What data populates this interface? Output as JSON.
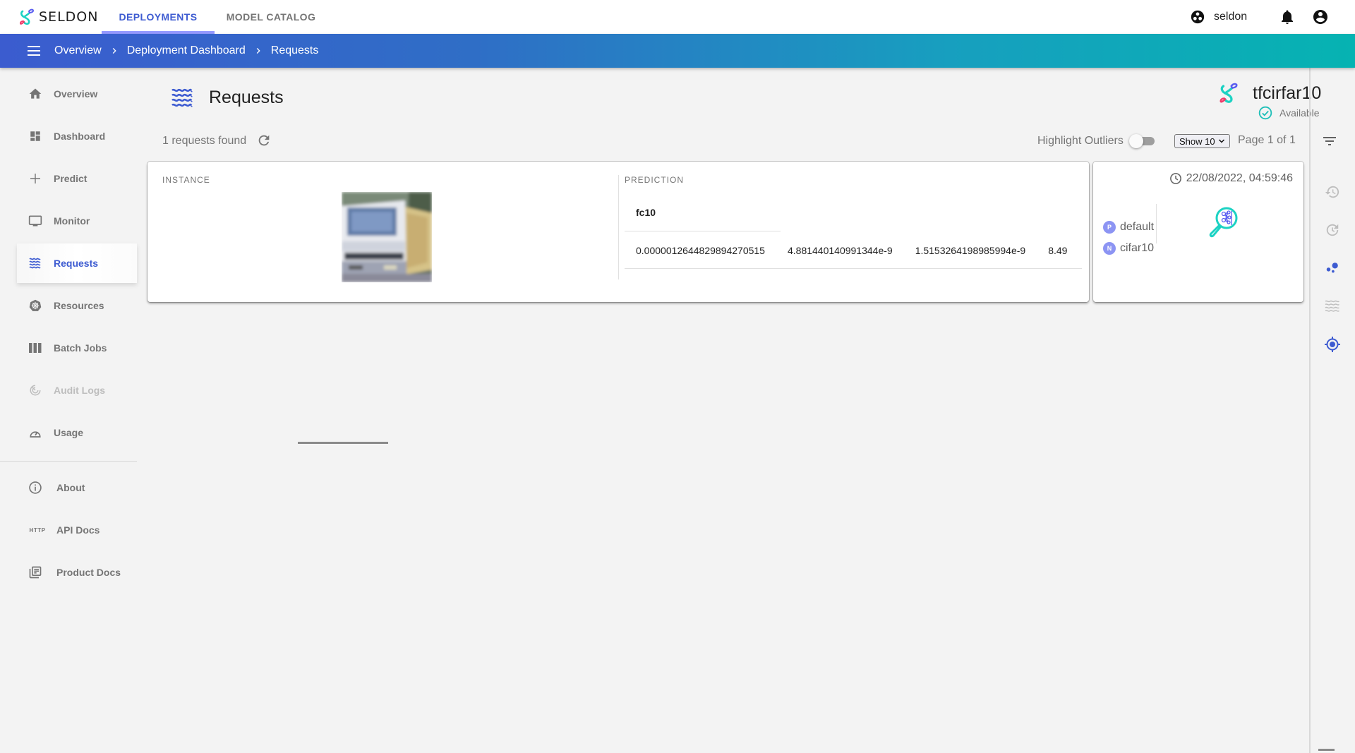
{
  "app": {
    "brand": "SELDON",
    "nav_tabs": [
      {
        "label": "DEPLOYMENTS",
        "active": true
      },
      {
        "label": "MODEL CATALOG",
        "active": false
      }
    ],
    "user": {
      "namespace_label": "seldon",
      "icons": [
        "namespace-icon",
        "bell-icon",
        "account-icon"
      ]
    }
  },
  "breadcrumb": [
    "Overview",
    "Deployment Dashboard",
    "Requests"
  ],
  "sidebar": {
    "items": [
      {
        "label": "Overview",
        "icon": "home-icon",
        "state": "normal"
      },
      {
        "label": "Dashboard",
        "icon": "dashboard-icon",
        "state": "normal"
      },
      {
        "label": "Predict",
        "icon": "plus-icon",
        "state": "normal"
      },
      {
        "label": "Monitor",
        "icon": "monitor-icon",
        "state": "normal"
      },
      {
        "label": "Requests",
        "icon": "waves-icon",
        "state": "active"
      },
      {
        "label": "Resources",
        "icon": "kubernetes-icon",
        "state": "normal"
      },
      {
        "label": "Batch Jobs",
        "icon": "batch-icon",
        "state": "normal"
      },
      {
        "label": "Audit Logs",
        "icon": "audit-icon",
        "state": "disabled"
      },
      {
        "label": "Usage",
        "icon": "gauge-icon",
        "state": "normal"
      }
    ],
    "lower_items": [
      {
        "label": "About",
        "icon": "info-icon"
      },
      {
        "label": "API Docs",
        "icon": "http-icon",
        "icon_text": "HTTP"
      },
      {
        "label": "Product Docs",
        "icon": "docs-icon"
      }
    ]
  },
  "page": {
    "title": "Requests",
    "deployment": {
      "name": "tfcirfar10",
      "status": "Available"
    },
    "requests_found": "1 requests found",
    "highlight_outliers_label": "Highlight Outliers",
    "highlight_outliers_on": false,
    "page_size_selected": "Show 10",
    "page_info": "Page 1 of 1"
  },
  "request": {
    "instance_label": "INSTANCE",
    "prediction_label": "PREDICTION",
    "prediction_column": "fc10",
    "prediction_values": [
      "0.0000012644829894270515",
      "4.881440140991344e-9",
      "1.5153264198985994e-9",
      "8.49"
    ],
    "timestamp": "22/08/2022, 04:59:46",
    "chips": [
      {
        "letter": "P",
        "label": "default"
      },
      {
        "letter": "N",
        "label": "cifar10"
      }
    ]
  },
  "rail": {
    "buttons": [
      {
        "icon": "history-icon",
        "active": false
      },
      {
        "icon": "refresh-clock-icon",
        "active": false
      },
      {
        "icon": "scatter-icon",
        "active": true
      },
      {
        "icon": "waves-icon",
        "active": false
      },
      {
        "icon": "target-icon",
        "active": true
      }
    ]
  },
  "colors": {
    "primary": "#3d5bd1",
    "teal": "#06b3b2",
    "tab_underline": "#9499ff",
    "chip": "#8c94f3",
    "available": "#1fbfb8"
  }
}
